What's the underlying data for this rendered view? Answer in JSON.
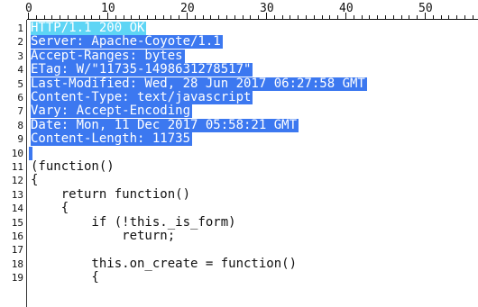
{
  "ruler": {
    "labels": [
      "0",
      "10",
      "20",
      "30",
      "40",
      "50"
    ]
  },
  "colors": {
    "selection": "#3c78f0",
    "selection_first_line": "#5ed5f5",
    "text": "#111111",
    "background": "#ffffff"
  },
  "lines": [
    {
      "num": "1",
      "text": "HTTP/1.1 200 OK",
      "selected": true
    },
    {
      "num": "2",
      "text": "Server: Apache-Coyote/1.1",
      "selected": true
    },
    {
      "num": "3",
      "text": "Accept-Ranges: bytes",
      "selected": true
    },
    {
      "num": "4",
      "text": "ETag: W/\"11735-1498631278517\"",
      "selected": true
    },
    {
      "num": "5",
      "text": "Last-Modified: Wed, 28 Jun 2017 06:27:58 GMT",
      "selected": true
    },
    {
      "num": "6",
      "text": "Content-Type: text/javascript",
      "selected": true
    },
    {
      "num": "7",
      "text": "Vary: Accept-Encoding",
      "selected": true
    },
    {
      "num": "8",
      "text": "Date: Mon, 11 Dec 2017 05:58:21 GMT",
      "selected": true
    },
    {
      "num": "9",
      "text": "Content-Length: 11735",
      "selected": true
    },
    {
      "num": "10",
      "text": "",
      "selected": true
    },
    {
      "num": "11",
      "text": "(function()",
      "selected": false
    },
    {
      "num": "12",
      "text": "{",
      "selected": false
    },
    {
      "num": "13",
      "text": "    return function()",
      "selected": false
    },
    {
      "num": "14",
      "text": "    {",
      "selected": false
    },
    {
      "num": "15",
      "text": "        if (!this._is_form)",
      "selected": false
    },
    {
      "num": "16",
      "text": "            return;",
      "selected": false
    },
    {
      "num": "17",
      "text": "",
      "selected": false
    },
    {
      "num": "18",
      "text": "        this.on_create = function()",
      "selected": false
    },
    {
      "num": "19",
      "text": "        {",
      "selected": false
    }
  ]
}
